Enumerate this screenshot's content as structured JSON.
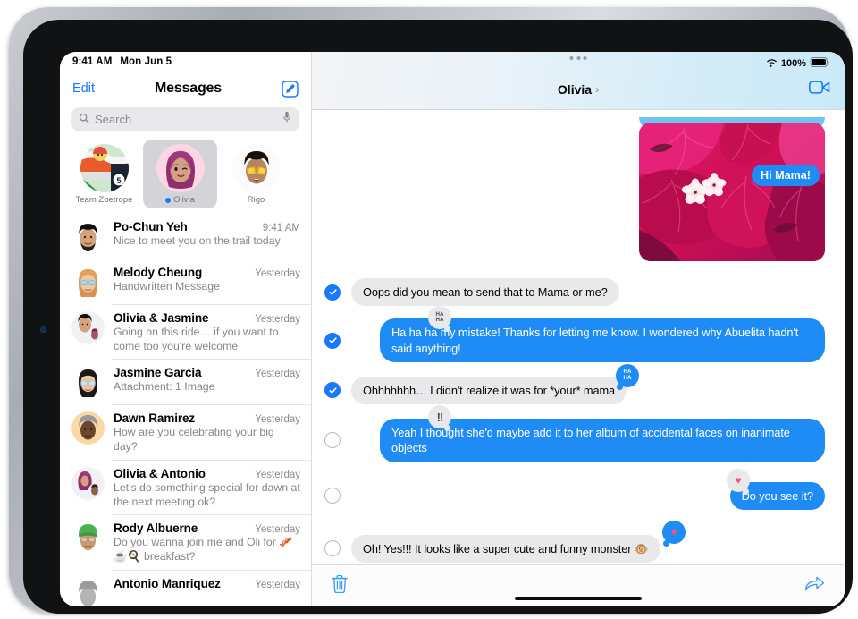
{
  "device": {
    "name": "ipad-pro"
  },
  "statusbar_left": {
    "time": "9:41 AM",
    "date": "Mon Jun 5"
  },
  "statusbar_right": {
    "wifi_icon": "wifi-icon",
    "battery_percent": "100%",
    "battery_icon": "battery-full-icon"
  },
  "sidebar": {
    "edit_label": "Edit",
    "title": "Messages",
    "compose_icon": "compose-icon",
    "search": {
      "placeholder": "Search",
      "search_icon": "search-icon",
      "mic_icon": "microphone-icon"
    },
    "pinned": [
      {
        "label": "Team Zoetrope",
        "selected": false,
        "unread": false,
        "avatar": "group-8ball-avatar"
      },
      {
        "label": "Olivia",
        "selected": true,
        "unread": true,
        "avatar": "olivia-memoji-avatar"
      },
      {
        "label": "Rigo",
        "selected": false,
        "unread": false,
        "avatar": "rigo-memoji-avatar"
      }
    ],
    "conversations": [
      {
        "name": "Po-Chun Yeh",
        "time": "9:41 AM",
        "preview": "Nice to meet you on the trail today",
        "avatar": "po-chun-memoji-avatar"
      },
      {
        "name": "Melody Cheung",
        "time": "Yesterday",
        "preview": "Handwritten Message",
        "avatar": "melody-memoji-avatar"
      },
      {
        "name": "Olivia & Jasmine",
        "time": "Yesterday",
        "preview": "Going on this ride… if you want to come too you're welcome",
        "avatar": "group-olivia-jasmine-avatar"
      },
      {
        "name": "Jasmine Garcia",
        "time": "Yesterday",
        "preview": "Attachment: 1 Image",
        "avatar": "jasmine-memoji-avatar"
      },
      {
        "name": "Dawn Ramirez",
        "time": "Yesterday",
        "preview": "How are you celebrating your big day?",
        "avatar": "dawn-memoji-avatar"
      },
      {
        "name": "Olivia & Antonio",
        "time": "Yesterday",
        "preview": "Let's do something special for dawn at the next meeting ok?",
        "avatar": "group-olivia-antonio-avatar"
      },
      {
        "name": "Rody Albuerne",
        "time": "Yesterday",
        "preview": "Do you wanna join me and Oli for 🥓☕🍳 breakfast?",
        "avatar": "rody-memoji-avatar"
      },
      {
        "name": "Antonio Manriquez",
        "time": "Yesterday",
        "preview": "",
        "avatar": "antonio-memoji-avatar"
      }
    ]
  },
  "conversation": {
    "multitask_icon": "multitasking-dots-icon",
    "title": "Olivia",
    "title_chevron_icon": "chevron-right-icon",
    "facetime_icon": "facetime-video-icon",
    "photo_message": {
      "image_description": "pink-bougainvillea-flowers-photo",
      "overlay_bubble": "Hi Mama!"
    },
    "messages": [
      {
        "text": "Oops did you mean to send that to Mama or me?",
        "side": "in",
        "selected": true,
        "tapback": null
      },
      {
        "text": "Ha ha ha my mistake! Thanks for letting me know. I wondered why Abuelita hadn't said anything!",
        "side": "out",
        "selected": true,
        "tapback": {
          "type": "haha",
          "style": "gray",
          "anchor": "left"
        }
      },
      {
        "text": "Ohhhhhhh… I didn't realize it was for *your* mama",
        "side": "in",
        "selected": true,
        "tapback": {
          "type": "haha",
          "style": "blue",
          "anchor": "right"
        }
      },
      {
        "text": "Yeah I thought she'd maybe add it to her album of accidental faces on inanimate objects",
        "side": "out",
        "selected": false,
        "tapback": {
          "type": "exclaim",
          "style": "gray",
          "anchor": "left"
        }
      },
      {
        "text": "Do you see it?",
        "side": "out",
        "selected": false,
        "tapback": {
          "type": "heart",
          "style": "gray",
          "anchor": "left"
        }
      },
      {
        "text": "Oh! Yes!!! It looks like a super cute and funny monster 🐵",
        "side": "in",
        "selected": false,
        "tapback": {
          "type": "heart",
          "style": "blue",
          "anchor": "right"
        }
      }
    ],
    "toolbar": {
      "delete_icon": "trash-icon",
      "forward_icon": "forward-arrow-icon"
    }
  },
  "colors": {
    "accent_blue": "#1878ff",
    "bubble_out": "#1f8cf5",
    "bubble_in": "#e9e9eb",
    "tapback_heart": "#ff4d7e"
  },
  "tapback_glyphs": {
    "haha": "HA\nHA",
    "exclaim": "!!",
    "heart": "♥"
  }
}
